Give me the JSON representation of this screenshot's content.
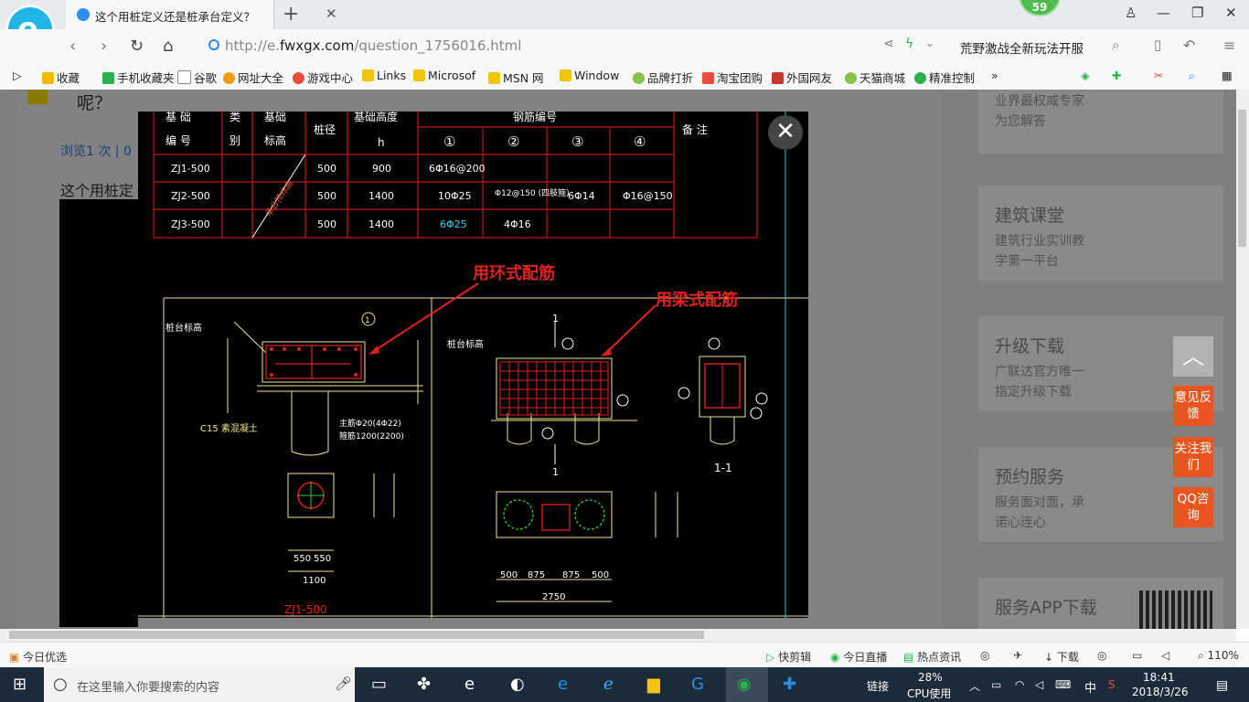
{
  "browser": {
    "tab_title": "这个用桩定义还是桩承台定义？如",
    "badge_count": "59",
    "url_prefix": "http://e.",
    "url_domain": "fwxgx.com",
    "url_path": "/question_1756016.html",
    "promo_text": "荒野激战全新玩法开服"
  },
  "bookmarks": [
    "收藏",
    "手机收藏夹",
    "谷歌",
    "网址大全",
    "游戏中心",
    "Links",
    "Microsof",
    "MSN 网",
    "Window",
    "品牌打折",
    "淘宝团购",
    "外国网友",
    "天猫商城",
    "精准控制"
  ],
  "page": {
    "question_tail": "呢？",
    "views": "浏览1 次 | 0",
    "body_start": "这个用桩定"
  },
  "sidebar": {
    "cards": [
      {
        "title": "",
        "sub": "业界最权威专家\n为您解答"
      },
      {
        "title": "建筑课堂",
        "sub": "建筑行业实训教\n学第一平台"
      },
      {
        "title": "升级下载",
        "sub": "广联达官方唯一\n指定升级下载"
      },
      {
        "title": "预约服务",
        "sub": "服务面对面，承\n诺心连心"
      },
      {
        "title": "服务APP下载",
        "sub": ""
      }
    ],
    "buttons": [
      "意见反馈",
      "关注我们",
      "QQ咨询"
    ]
  },
  "drawing": {
    "table_head": [
      "基 础\n编 号",
      "类\n别",
      "基础\n标高",
      "桩径",
      "基础高度\nh",
      "钢筋编号",
      "备  注"
    ],
    "rebar_nums": [
      "①",
      "②",
      "③",
      "④"
    ],
    "rows": [
      [
        "ZJ1-500",
        "500",
        "900",
        "6Φ16@200",
        "",
        "",
        ""
      ],
      [
        "ZJ2-500",
        "500",
        "1400",
        "10Φ25",
        "Φ12@150\n(四肢箍)",
        "6Φ14",
        "Φ16@150"
      ],
      [
        "ZJ3-500",
        "500",
        "1400",
        "6Φ25",
        "4Φ16",
        "",
        ""
      ]
    ],
    "note_ring": "用环式配筋",
    "note_beam": "用梁式配筋",
    "cap_label": "桩台标高",
    "label_zj1": "ZJ1-500",
    "section_label": "1-1",
    "dims_left": [
      "550",
      "550",
      "1100"
    ],
    "dims_bottom": [
      "500",
      "875",
      "875",
      "500",
      "2750"
    ]
  },
  "statusbar": {
    "left": "今日优选",
    "items": [
      "快剪辑",
      "今日直播",
      "热点资讯"
    ],
    "download": "下载",
    "zoom": "110%"
  },
  "taskbar": {
    "search_placeholder": "在这里输入你要搜索的内容",
    "link_label": "链接",
    "cpu_percent": "28%",
    "cpu_label": "CPU使用",
    "ime": "中",
    "time": "18:41",
    "date": "2018/3/26"
  }
}
